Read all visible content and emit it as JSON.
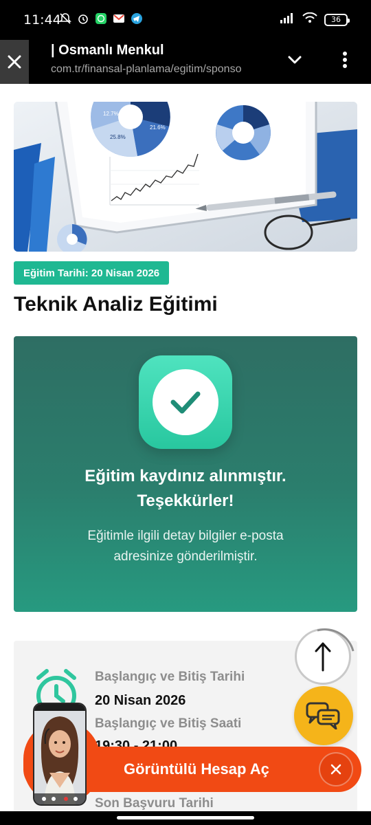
{
  "status_bar": {
    "time": "11:44",
    "battery": "36"
  },
  "browser": {
    "title": "| Osmanlı Menkul",
    "url": "com.tr/finansal-planlama/egitim/sponso"
  },
  "hero": {
    "image": "financial-charts-tablet-pen-glasses"
  },
  "event": {
    "date_badge": "Eğitim Tarihi: 20 Nisan 2026",
    "title": "Teknik Analiz Eğitimi"
  },
  "success": {
    "title_line1": "Eğitim kaydınız alınmıştır.",
    "title_line2": "Teşekkürler!",
    "text_line1": "Eğitimle ilgili detay bilgiler e-posta",
    "text_line2": "adresinize gönderilmiştir."
  },
  "info": {
    "date_label": "Başlangıç ve Bitiş Tarihi",
    "date_value": "20 Nisan 2026",
    "time_label": "Başlangıç ve Bitiş Saati",
    "time_value": "19:30 - 21:00",
    "deadline_label": "Son Başvuru Tarihi"
  },
  "cta": {
    "label": "Görüntülü Hesap Aç"
  },
  "colors": {
    "accent_green": "#1fb892",
    "card_green": "#2b7e6d",
    "cta_orange": "#f14a14",
    "chat_yellow": "#f5b41a"
  },
  "icons": [
    "close-icon",
    "chevron-down-icon",
    "more-vert-icon",
    "check-icon",
    "alarm-clock-icon",
    "arrow-up-icon",
    "chat-bubbles-icon",
    "close-x-icon"
  ]
}
